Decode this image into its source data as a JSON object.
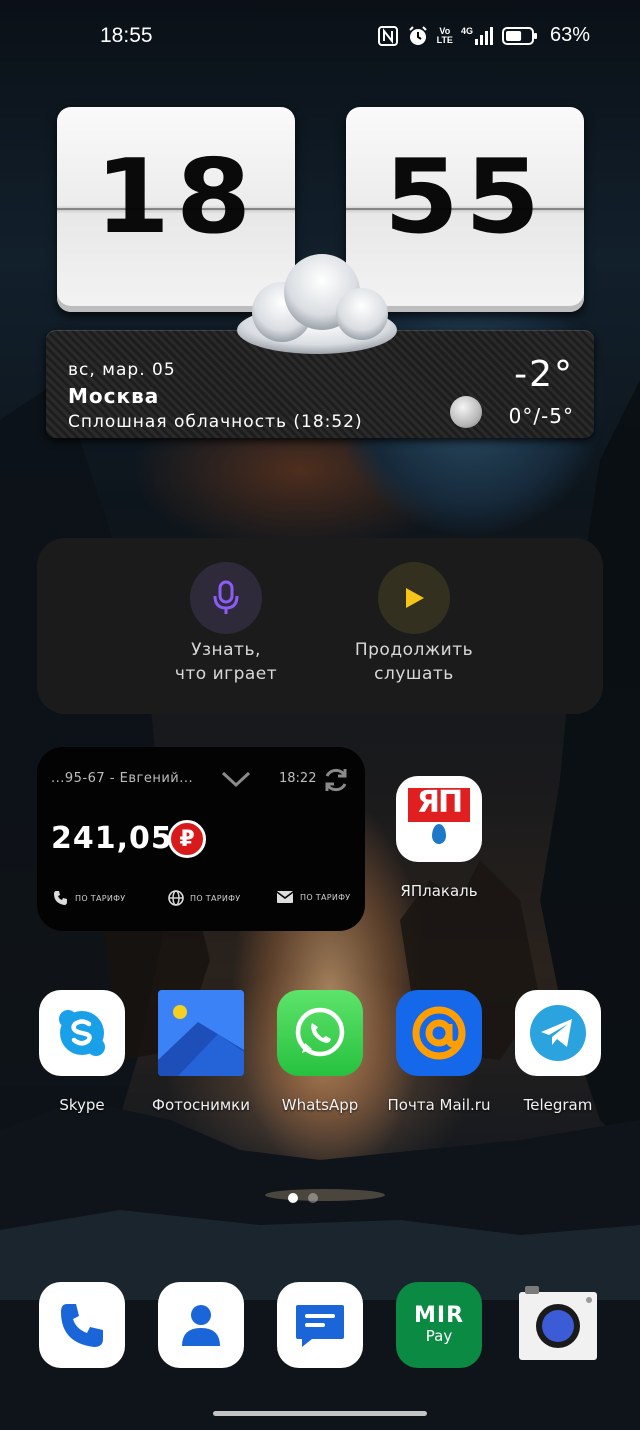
{
  "status_bar": {
    "time": "18:55",
    "volte_top": "Vo",
    "volte_bottom": "LTE",
    "network": "4G",
    "battery_percent": "63%",
    "battery_level": 0.63
  },
  "clock_widget": {
    "hours": "18",
    "minutes": "55"
  },
  "weather_widget": {
    "date": "вс, мар. 05",
    "city": "Москва",
    "description": "Сплошная облачность (18:52)",
    "temperature": "-2°",
    "range": "0°/-5°"
  },
  "music_widget": {
    "recognize_label_line1": "Узнать,",
    "recognize_label_line2": "что играет",
    "continue_label_line1": "Продолжить",
    "continue_label_line2": "слушать",
    "mic_color": "#8b5cf6",
    "play_color": "#f5c518"
  },
  "balance_widget": {
    "account": "...95-67 - Евгений...",
    "updated_time": "18:22",
    "amount": "241,05",
    "currency_symbol": "₽",
    "calls_tariff": "ПО ТАРИФУ",
    "internet_tariff": "ПО ТАРИФУ",
    "sms_tariff": "ПО ТАРИФУ"
  },
  "apps": {
    "yaplakal": {
      "label": "ЯПлакаль",
      "icon_text": "ЯП"
    },
    "skype": {
      "label": "Skype"
    },
    "photos": {
      "label": "Фотоснимки"
    },
    "whatsapp": {
      "label": "WhatsApp"
    },
    "mailru": {
      "label": "Почта Mail.ru"
    },
    "telegram": {
      "label": "Telegram"
    }
  },
  "dock": {
    "mir_pay_top": "MIR",
    "mir_pay_bottom": "Pay"
  },
  "pager": {
    "pages": 2,
    "active": 1
  }
}
